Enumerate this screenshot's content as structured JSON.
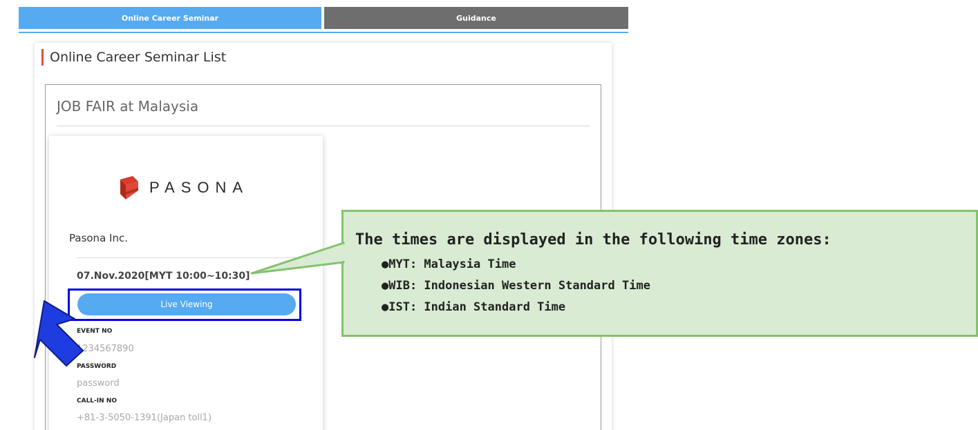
{
  "tabs": {
    "active_label": "Online Career Seminar",
    "inactive_label": "Guidance"
  },
  "list": {
    "title": "Online Career Seminar List"
  },
  "fair": {
    "title": "JOB FAIR at Malaysia"
  },
  "company": {
    "logo_text": "PASONA",
    "name": "Pasona Inc.",
    "schedule": "07.Nov.2020[MYT 10:00~10:30]",
    "live_button": "Live Viewing",
    "event_no_label": "EVENT NO",
    "event_no_value": "1234567890",
    "password_label": "PASSWORD",
    "password_value": "password",
    "callin_label": "CALL-IN NO",
    "callin_value": "+81-3-5050-1391(Japan toll1)"
  },
  "callout": {
    "heading": "The times are displayed in the following time zones:",
    "items": [
      "●MYT: Malaysia Time",
      "●WIB: Indonesian Western Standard Time",
      "●IST: Indian Standard Time"
    ]
  },
  "colors": {
    "accent_blue": "#56aaf0",
    "tab_inactive": "#6e6e6e",
    "title_bar_red": "#e84c3d",
    "logo_red": "#d83a2b",
    "callout_fill": "#d9ebd2",
    "callout_border": "#82c36d",
    "highlight_blue": "#0000e6"
  }
}
